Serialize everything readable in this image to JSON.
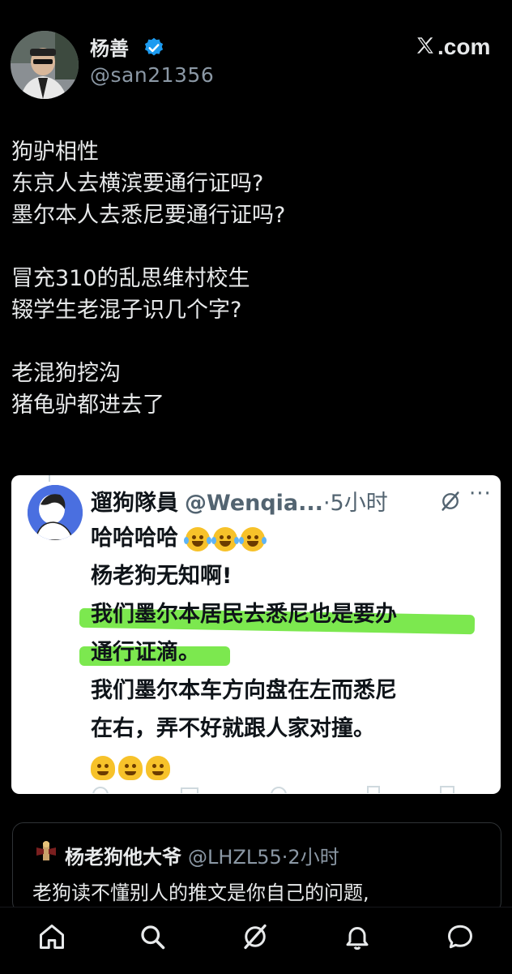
{
  "author": {
    "name": "杨善",
    "handle": "@san21356",
    "verified": true,
    "avatar_icon": "user-photo-avatar"
  },
  "brand": {
    "text": ".com",
    "logo_icon": "x-logo-icon"
  },
  "tweet": {
    "lines": [
      "狗驴相性",
      "东京人去横滨要通行证吗?",
      "墨尔本人去悉尼要通行证吗?",
      "",
      "冒充310的乱思维村校生",
      "辍学生老混子识几个字?",
      "",
      "老混狗挖沟",
      "猪龟驴都进去了"
    ]
  },
  "quoted": {
    "name": "遛狗隊員",
    "handle": "@Wenqia...",
    "separator": "·",
    "time": "5小时",
    "more": "···",
    "lines": [
      "哈哈哈哈",
      "杨老狗无知啊!",
      "我们墨尔本居民去悉尼也是要办",
      "通行证滴。",
      "我们墨尔本车方向盘在左而悉尼",
      "在右，弄不好就跟人家对撞。"
    ],
    "highlight_color": "#6ee63c"
  },
  "reply": {
    "name": "杨老狗他大爷",
    "handle": "@LHZL55",
    "separator": "·",
    "time": "2小时",
    "text": "老狗读不懂别人的推文是你自己的问题,"
  },
  "colors": {
    "background": "#000000",
    "text_primary": "#e7e9ea",
    "text_secondary": "#8b98a5",
    "verified_blue": "#1d9bf0"
  },
  "nav": [
    "home-icon",
    "search-icon",
    "grok-icon",
    "notifications-icon",
    "messages-icon"
  ]
}
